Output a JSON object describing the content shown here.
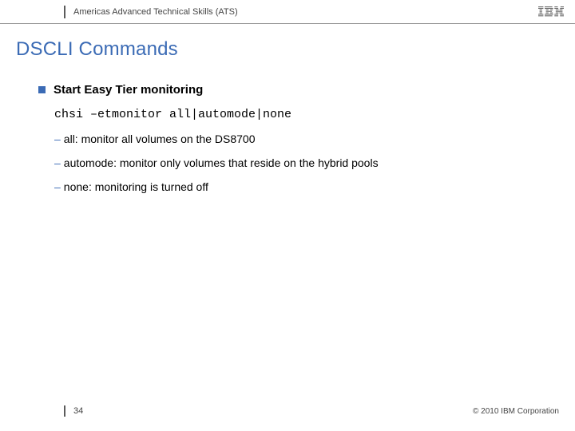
{
  "header": {
    "org": "Americas Advanced Technical Skills (ATS)",
    "logo": "IBM"
  },
  "title": "DSCLI Commands",
  "bullet": {
    "heading": "Start Easy Tier monitoring",
    "code": "chsi –etmonitor all|automode|none",
    "subs": [
      "all: monitor all volumes on the DS8700",
      "automode: monitor only volumes that reside on the hybrid pools",
      "none: monitoring is turned off"
    ]
  },
  "footer": {
    "page": "34",
    "copyright": "© 2010 IBM Corporation"
  }
}
